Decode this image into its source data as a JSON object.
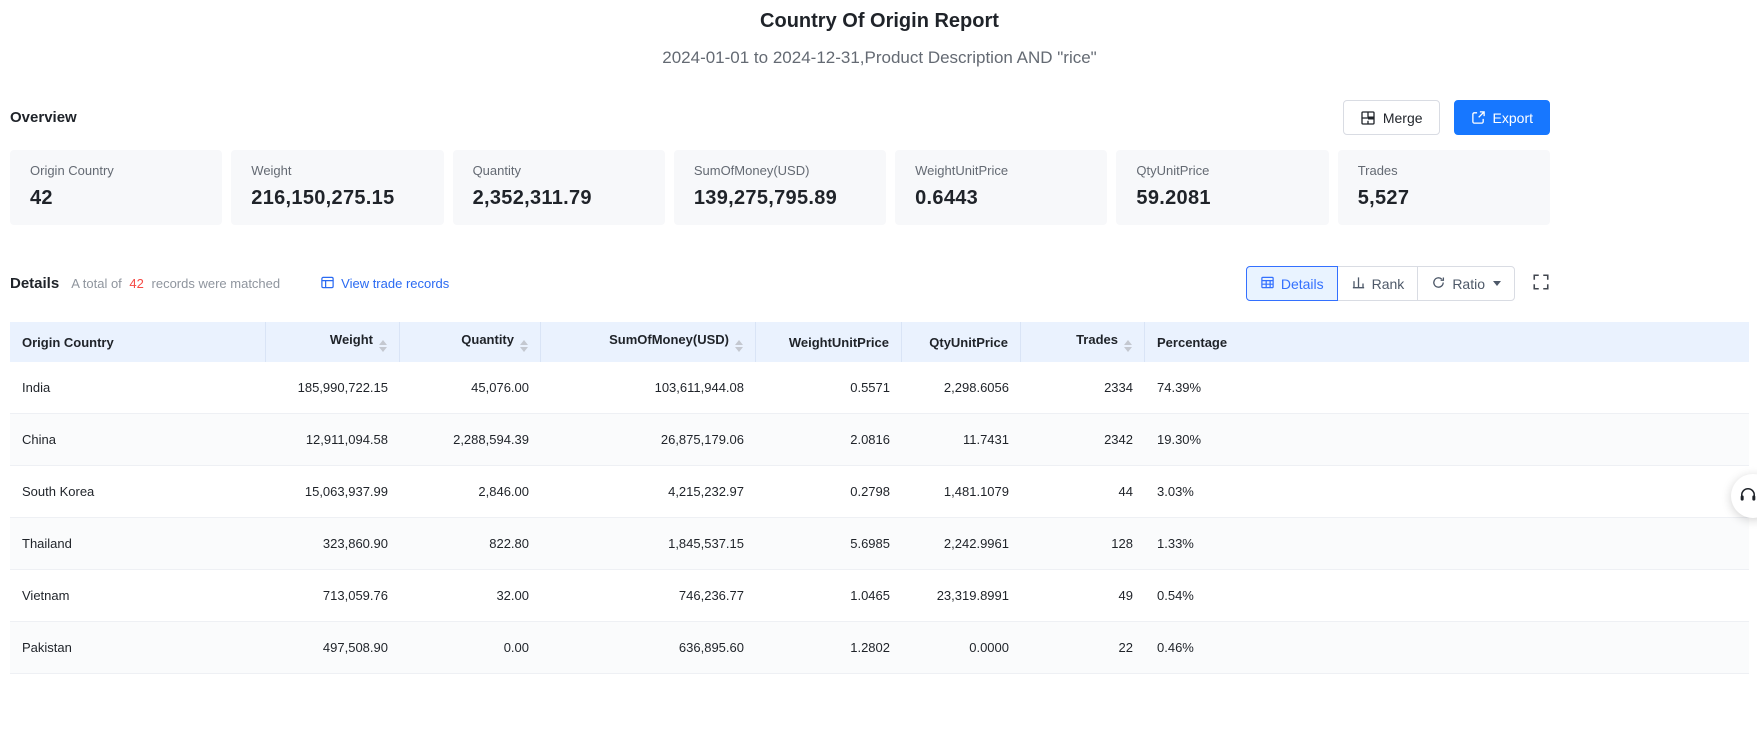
{
  "header": {
    "title": "Country Of Origin Report",
    "subtitle": "2024-01-01 to 2024-12-31,Product Description AND \"rice\""
  },
  "overview": {
    "section_label": "Overview",
    "merge_label": "Merge",
    "export_label": "Export",
    "cards": [
      {
        "label": "Origin Country",
        "value": "42"
      },
      {
        "label": "Weight",
        "value": "216,150,275.15"
      },
      {
        "label": "Quantity",
        "value": "2,352,311.79"
      },
      {
        "label": "SumOfMoney(USD)",
        "value": "139,275,795.89"
      },
      {
        "label": "WeightUnitPrice",
        "value": "0.6443"
      },
      {
        "label": "QtyUnitPrice",
        "value": "59.2081"
      },
      {
        "label": "Trades",
        "value": "5,527"
      }
    ]
  },
  "details": {
    "section_label": "Details",
    "matched_prefix": "A total of",
    "matched_count": "42",
    "matched_suffix": "records were matched",
    "view_trade_records_label": "View trade records",
    "view_buttons": {
      "details": "Details",
      "rank": "Rank",
      "ratio": "Ratio"
    }
  },
  "table": {
    "columns": [
      {
        "label": "Origin Country",
        "sortable": false,
        "align": "left"
      },
      {
        "label": "Weight",
        "sortable": true,
        "align": "right"
      },
      {
        "label": "Quantity",
        "sortable": true,
        "align": "right"
      },
      {
        "label": "SumOfMoney(USD)",
        "sortable": true,
        "align": "right"
      },
      {
        "label": "WeightUnitPrice",
        "sortable": false,
        "align": "right"
      },
      {
        "label": "QtyUnitPrice",
        "sortable": false,
        "align": "right"
      },
      {
        "label": "Trades",
        "sortable": true,
        "align": "right"
      },
      {
        "label": "Percentage",
        "sortable": false,
        "align": "left"
      }
    ],
    "rows": [
      [
        "India",
        "185,990,722.15",
        "45,076.00",
        "103,611,944.08",
        "0.5571",
        "2,298.6056",
        "2334",
        "74.39%"
      ],
      [
        "China",
        "12,911,094.58",
        "2,288,594.39",
        "26,875,179.06",
        "2.0816",
        "11.7431",
        "2342",
        "19.30%"
      ],
      [
        "South Korea",
        "15,063,937.99",
        "2,846.00",
        "4,215,232.97",
        "0.2798",
        "1,481.1079",
        "44",
        "3.03%"
      ],
      [
        "Thailand",
        "323,860.90",
        "822.80",
        "1,845,537.15",
        "5.6985",
        "2,242.9961",
        "128",
        "1.33%"
      ],
      [
        "Vietnam",
        "713,059.76",
        "32.00",
        "746,236.77",
        "1.0465",
        "23,319.8991",
        "49",
        "0.54%"
      ],
      [
        "Pakistan",
        "497,508.90",
        "0.00",
        "636,895.60",
        "1.2802",
        "0.0000",
        "22",
        "0.46%"
      ]
    ]
  },
  "colors": {
    "primary_blue": "#1777ff",
    "link_blue": "#2a6af2",
    "selected_segment_blue": "#3370ff",
    "count_red": "#f54a45",
    "table_header_bg": "#eaf2fe",
    "card_bg": "#f7f8fa"
  }
}
